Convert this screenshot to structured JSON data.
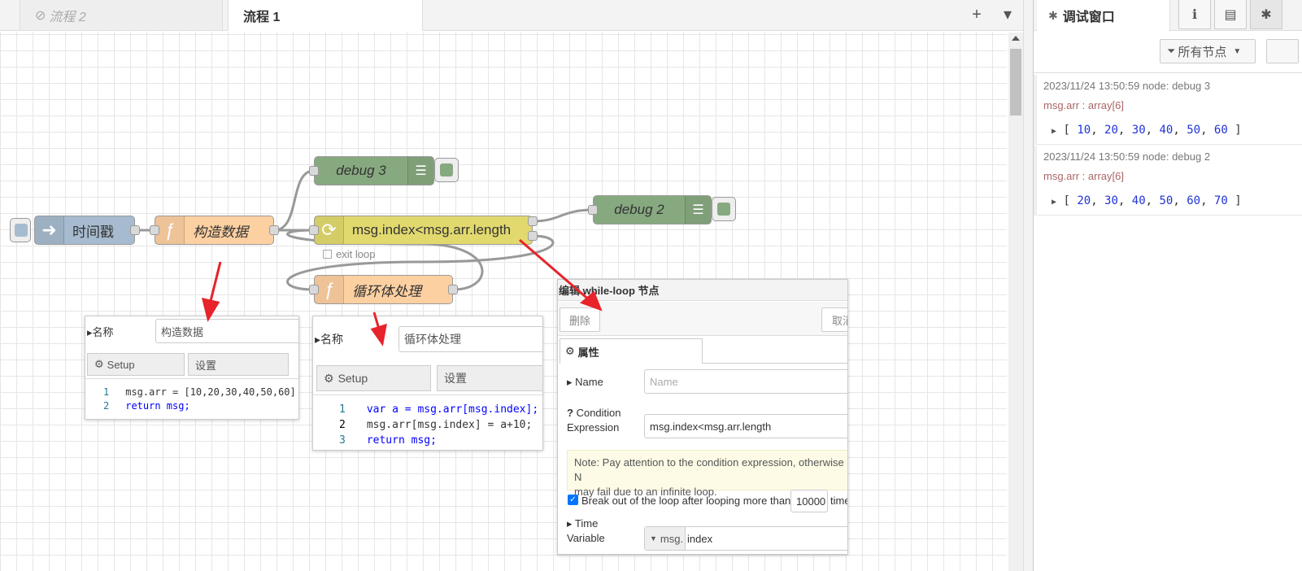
{
  "tabs": {
    "inactive_label": "流程 2",
    "active_label": "流程 1",
    "add_symbol": "+",
    "menu_symbol": "▾"
  },
  "nodes": {
    "inject": {
      "label": "时间戳",
      "color": "#a6bbcf"
    },
    "func_build": {
      "label": "构造数据",
      "color": "#fdd0a2"
    },
    "debug3": {
      "label": "debug 3",
      "color": "#87a980"
    },
    "while_loop": {
      "label": "msg.index<msg.arr.length",
      "color": "#e2d96e"
    },
    "debug2": {
      "label": "debug 2",
      "color": "#87a980"
    },
    "func_body": {
      "label": "循环体处理",
      "color": "#fdd0a2"
    },
    "exit_loop_label": "exit loop"
  },
  "panel_build": {
    "name_label": "名称",
    "name_value": "构造数据",
    "tab_setup": "Setup",
    "tab_settings": "设置",
    "code": [
      {
        "ln": "1",
        "text": "msg.arr = [10,20,30,40,50,60]"
      },
      {
        "ln": "2",
        "text": "return msg;"
      }
    ]
  },
  "panel_body": {
    "name_label": "名称",
    "name_value": "循环体处理",
    "tab_setup": "Setup",
    "tab_settings": "设置",
    "code": [
      {
        "ln": "1",
        "text": "var a = msg.arr[msg.index];"
      },
      {
        "ln": "2",
        "text": "msg.arr[msg.index] = a+10;"
      },
      {
        "ln": "3",
        "text": "return msg;"
      }
    ]
  },
  "panel_while": {
    "title": "编辑 while-loop 节点",
    "delete_button": "删除",
    "cancel_button": "取消",
    "properties_tab": "属性",
    "name_label": "Name",
    "name_placeholder": "Name",
    "condition_label_1": "Condition",
    "condition_label_2": "Expression",
    "condition_value": "msg.index<msg.arr.length",
    "note_line1": "Note: Pay attention to the condition expression, otherwise N",
    "note_line2": "may fail due to an infinite loop.",
    "break_label": "Break out of the loop after looping more than",
    "break_value": "10000",
    "break_suffix": "time",
    "break_checked": true,
    "time_label_1": "Time",
    "time_label_2": "Variable",
    "time_type": "msg.",
    "time_value": "index"
  },
  "sidebar": {
    "title": "调试窗口",
    "filter_label": "所有节点",
    "messages": [
      {
        "meta": "2023/11/24 13:50:59   node: debug 3",
        "topic": "msg.arr : array[6]",
        "values": [
          "10",
          "20",
          "30",
          "40",
          "50",
          "60"
        ]
      },
      {
        "meta": "2023/11/24 13:50:59   node: debug 2",
        "topic": "msg.arr : array[6]",
        "values": [
          "20",
          "30",
          "40",
          "50",
          "60",
          "70"
        ]
      }
    ]
  }
}
